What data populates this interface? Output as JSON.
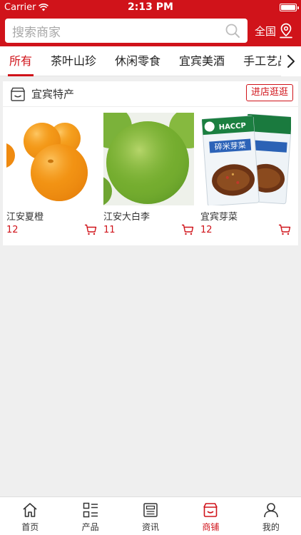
{
  "status_bar": {
    "carrier": "Carrier",
    "time": "2:13 PM"
  },
  "search": {
    "placeholder": "搜索商家",
    "region_label": "全国"
  },
  "categories": [
    {
      "label": "所有",
      "active": true
    },
    {
      "label": "茶叶山珍"
    },
    {
      "label": "休闲零食"
    },
    {
      "label": "宜宾美酒"
    },
    {
      "label": "手工艺品"
    }
  ],
  "shop": {
    "name": "宜宾特产",
    "visit_label": "进店逛逛",
    "products": [
      {
        "name": "江安夏橙",
        "price": "12"
      },
      {
        "name": "江安大白李",
        "price": "11"
      },
      {
        "name": "宜宾芽菜",
        "price": "12"
      }
    ]
  },
  "product_art": {
    "package_badge": "HACCP",
    "package_title": "碎米芽菜"
  },
  "colors": {
    "brand_red": "#d0131a"
  },
  "tabbar": [
    {
      "label": "首页",
      "icon": "home-icon"
    },
    {
      "label": "产品",
      "icon": "grid-list-icon"
    },
    {
      "label": "资讯",
      "icon": "news-icon"
    },
    {
      "label": "商铺",
      "icon": "store-icon",
      "active": true
    },
    {
      "label": "我的",
      "icon": "user-icon"
    }
  ]
}
